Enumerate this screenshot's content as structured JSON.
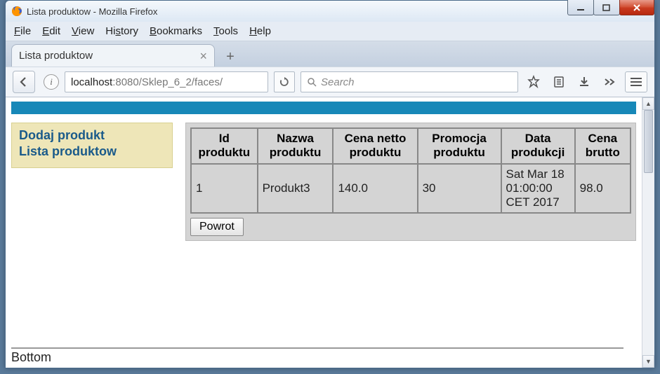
{
  "window": {
    "title": "Lista produktow - Mozilla Firefox"
  },
  "menubar": {
    "file": "File",
    "edit": "Edit",
    "view": "View",
    "history": "History",
    "bookmarks": "Bookmarks",
    "tools": "Tools",
    "help": "Help"
  },
  "tab": {
    "title": "Lista produktow"
  },
  "url": {
    "host": "localhost",
    "rest": ":8080/Sklep_6_2/faces/"
  },
  "search": {
    "placeholder": "Search"
  },
  "sidenav": {
    "add": "Dodaj produkt",
    "list": "Lista produktow"
  },
  "table": {
    "headers": {
      "id": "Id produktu",
      "name": "Nazwa produktu",
      "netprice": "Cena netto produktu",
      "promo": "Promocja produktu",
      "date": "Data produkcji",
      "gross": "Cena brutto"
    },
    "rows": [
      {
        "id": "1",
        "name": "Produkt3",
        "netprice": "140.0",
        "promo": "30",
        "date": "Sat Mar 18 01:00:00 CET 2017",
        "gross": "98.0"
      }
    ]
  },
  "buttons": {
    "return": "Powrot"
  },
  "footer": {
    "bottom": "Bottom"
  }
}
